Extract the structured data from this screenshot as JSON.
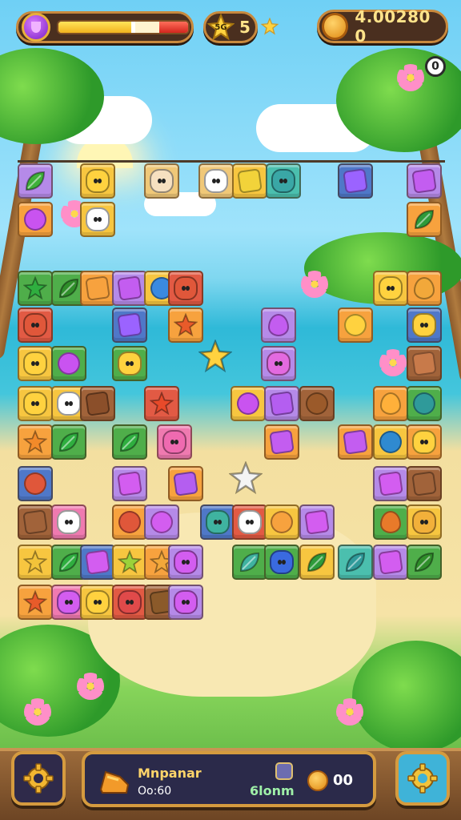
{
  "hud": {
    "energy": {
      "icon": "gem-icon",
      "fill_yellow_fraction": 0.56,
      "fill_red_fraction": 0.22
    },
    "stars": {
      "badge_text": "5G",
      "count": "5",
      "plus_icon": "star-plus-icon"
    },
    "coins": {
      "icon": "coin-icon",
      "value": "4.00280 0"
    },
    "timer_badge": "0"
  },
  "board": {
    "tiles": [
      {
        "c": "t-purple",
        "p": "leaf",
        "pc": "#3fb13a"
      },
      {
        "c": "t-yellow",
        "p": "face",
        "pc": "#ffd23f"
      },
      {
        "c": "t-sand",
        "p": "face",
        "pc": "#f6e0c0"
      },
      {
        "c": "t-sand",
        "p": "face",
        "pc": "#ffffff"
      },
      {
        "c": "t-yellow",
        "p": "square",
        "pc": "#f2d33a"
      },
      {
        "c": "t-teal",
        "p": "face",
        "pc": "#3aa7a6"
      },
      {
        "c": "t-blue",
        "p": "square",
        "pc": "#9b63ff"
      },
      {
        "c": "t-purple",
        "p": "square",
        "pc": "#c35df0"
      },
      {
        "c": "t-orange",
        "p": "circle",
        "pc": "#c953f0"
      },
      {
        "c": "t-yellow",
        "p": "face",
        "pc": "#ffffff"
      },
      {
        "c": "t-orange",
        "p": "leaf",
        "pc": "#2f9a3a"
      },
      {
        "c": "t-green",
        "p": "star",
        "pc": "#2fae3f"
      },
      {
        "c": "t-green",
        "p": "leaf",
        "pc": "#2f8e2a"
      },
      {
        "c": "t-orange",
        "p": "square",
        "pc": "#f7a23e"
      },
      {
        "c": "t-purple",
        "p": "square",
        "pc": "#c35df0"
      },
      {
        "c": "t-yellow",
        "p": "circle",
        "pc": "#3a8ae0"
      },
      {
        "c": "t-red",
        "p": "face",
        "pc": "#e0573a"
      },
      {
        "c": "t-yellow",
        "p": "face",
        "pc": "#ffd23f"
      },
      {
        "c": "t-orange",
        "p": "drop",
        "pc": "#f2a83a"
      },
      {
        "c": "t-red",
        "p": "face",
        "pc": "#e0573a"
      },
      {
        "c": "t-blue",
        "p": "square",
        "pc": "#9b63ff"
      },
      {
        "c": "t-orange",
        "p": "star",
        "pc": "#e85b2a"
      },
      {
        "c": "t-purple",
        "p": "drop",
        "pc": "#c35df0"
      },
      {
        "c": "t-orange",
        "p": "circle",
        "pc": "#ffd23f"
      },
      {
        "c": "t-blue",
        "p": "face",
        "pc": "#ffd23f"
      },
      {
        "c": "t-yellow",
        "p": "face",
        "pc": "#ffd23f"
      },
      {
        "c": "t-green",
        "p": "circle",
        "pc": "#c953f0"
      },
      {
        "c": "t-green",
        "p": "face",
        "pc": "#ffd23f"
      },
      {
        "c": "t-purple",
        "p": "face",
        "pc": "#e36ae0"
      },
      {
        "c": "t-brown",
        "p": "square",
        "pc": "#c87a4a"
      },
      {
        "c": "t-yellow",
        "p": "face",
        "pc": "#ffd23f"
      },
      {
        "c": "t-yellow",
        "p": "face",
        "pc": "#ffffff"
      },
      {
        "c": "t-brown",
        "p": "square",
        "pc": "#8b4f2a"
      },
      {
        "c": "t-red",
        "p": "star",
        "pc": "#e84a2a"
      },
      {
        "c": "t-yellow",
        "p": "circle",
        "pc": "#c953f0"
      },
      {
        "c": "t-purple",
        "p": "square",
        "pc": "#b45ef0"
      },
      {
        "c": "t-brown",
        "p": "circle",
        "pc": "#9b5a2a"
      },
      {
        "c": "t-orange",
        "p": "drop",
        "pc": "#ffb03a"
      },
      {
        "c": "t-green",
        "p": "circle",
        "pc": "#2f9a9a"
      },
      {
        "c": "t-orange",
        "p": "star",
        "pc": "#f28a2a"
      },
      {
        "c": "t-green",
        "p": "leaf",
        "pc": "#2fae3f"
      },
      {
        "c": "t-green",
        "p": "leaf",
        "pc": "#2fae3f"
      },
      {
        "c": "t-pink",
        "p": "face",
        "pc": "#ef6ab0"
      },
      {
        "c": "t-orange",
        "p": "square",
        "pc": "#c35df0"
      },
      {
        "c": "t-orange",
        "p": "square",
        "pc": "#c35df0"
      },
      {
        "c": "t-yellow",
        "p": "circle",
        "pc": "#2f8ad0"
      },
      {
        "c": "t-orange",
        "p": "face",
        "pc": "#ffd23f"
      },
      {
        "c": "t-blue",
        "p": "circle",
        "pc": "#e0573a"
      },
      {
        "c": "t-purple",
        "p": "square",
        "pc": "#d35df0"
      },
      {
        "c": "t-orange",
        "p": "square",
        "pc": "#b45ef0"
      },
      {
        "c": "t-purple",
        "p": "square",
        "pc": "#d35df0"
      },
      {
        "c": "t-brown",
        "p": "square",
        "pc": "#a1633a"
      },
      {
        "c": "t-brown",
        "p": "square",
        "pc": "#a1633a"
      },
      {
        "c": "t-pink",
        "p": "face",
        "pc": "#ffffff"
      },
      {
        "c": "t-orange",
        "p": "circle",
        "pc": "#e0573a"
      },
      {
        "c": "t-purple",
        "p": "circle",
        "pc": "#d35df0"
      },
      {
        "c": "t-blue",
        "p": "face",
        "pc": "#3fb3a0"
      },
      {
        "c": "t-red",
        "p": "face",
        "pc": "#ffffff"
      },
      {
        "c": "t-yellow",
        "p": "circle",
        "pc": "#f7a23e"
      },
      {
        "c": "t-purple",
        "p": "square",
        "pc": "#d35df0"
      },
      {
        "c": "t-green",
        "p": "drop",
        "pc": "#e87a2a"
      },
      {
        "c": "t-yellow",
        "p": "face",
        "pc": "#f2b03a"
      },
      {
        "c": "t-yellow",
        "p": "star",
        "pc": "#f2c33a"
      },
      {
        "c": "t-green",
        "p": "leaf",
        "pc": "#2fae3f"
      },
      {
        "c": "t-blue",
        "p": "square",
        "pc": "#d35df0"
      },
      {
        "c": "t-yellow",
        "p": "star",
        "pc": "#9bd23a"
      },
      {
        "c": "t-orange",
        "p": "star",
        "pc": "#f2a83a"
      },
      {
        "c": "t-purple",
        "p": "face",
        "pc": "#d35df0"
      },
      {
        "c": "t-green",
        "p": "leaf",
        "pc": "#3fb3a0"
      },
      {
        "c": "t-green",
        "p": "face",
        "pc": "#3a6ae0"
      },
      {
        "c": "t-yellow",
        "p": "leaf",
        "pc": "#2f9a3a"
      },
      {
        "c": "t-teal",
        "p": "leaf",
        "pc": "#2f9a9a"
      },
      {
        "c": "t-purple",
        "p": "square",
        "pc": "#d35df0"
      },
      {
        "c": "t-green",
        "p": "leaf",
        "pc": "#2f8e2a"
      },
      {
        "c": "t-orange",
        "p": "star",
        "pc": "#e85b2a"
      },
      {
        "c": "t-pink",
        "p": "face",
        "pc": "#d35df0"
      },
      {
        "c": "t-yellow",
        "p": "face",
        "pc": "#ffd23f"
      },
      {
        "c": "t-red",
        "p": "face",
        "pc": "#e04a4a"
      },
      {
        "c": "t-brown",
        "p": "square",
        "pc": "#8b5a2a"
      },
      {
        "c": "t-purple",
        "p": "face",
        "pc": "#d35df0"
      }
    ],
    "loose_pieces": [
      {
        "name": "loose-star-piece",
        "p": "star",
        "pc": "#ffd23f"
      },
      {
        "name": "loose-snowflake-piece",
        "p": "star",
        "pc": "#f4f4f4"
      }
    ]
  },
  "bottom": {
    "left_button_icon": "gear-icon",
    "right_button_icon": "gear-icon",
    "mode_icon": "boot-icon",
    "mode_title": "Mnpanar",
    "mode_time": "Oo:60",
    "score_label": "6lonm",
    "coin_count": "00"
  }
}
